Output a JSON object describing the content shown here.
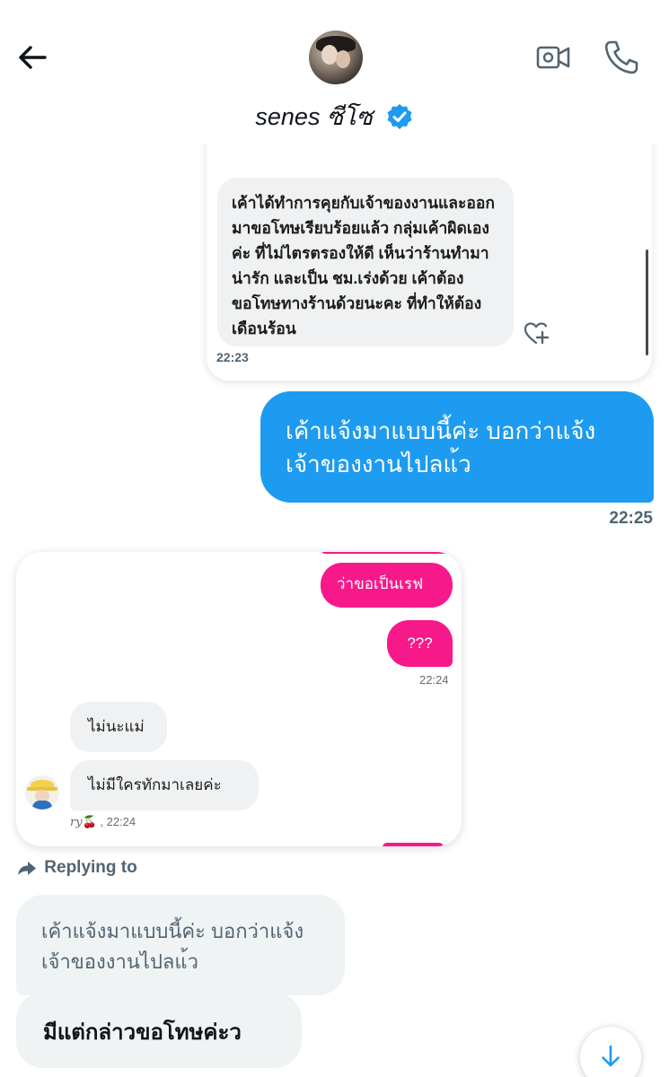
{
  "header": {
    "title": "senes ซีโซ",
    "verified": true,
    "icons": [
      "back-arrow-icon",
      "video-call-icon",
      "phone-call-icon",
      "verified-badge-icon"
    ]
  },
  "card1": {
    "message": "เค้าได้ทำการคุยกับเจ้าของงานและออกมาขอโทษเรียบร้อยแล้ว กลุ่มเค้าผิดเองค่ะ ที่ไม่ไตรตรองให้ดี เห็นว่าร้านทำมาน่ารัก และเป็น ชม.เร่งด้วย เค้าต้องขอโทษทางร้านด้วยนะคะ ที่ทำให้ต้องเดือนร้อน",
    "time": "22:23"
  },
  "outgoing": {
    "message": "เค้าแจ้งมาแบบนี้ค่ะ บอกว่าแจ้งเจ้าของงานไปลแ้ว",
    "time": "22:25",
    "color": "#1d9bf0"
  },
  "card2": {
    "pink_messages": [
      "ว่าขอเป็นเรฟ",
      "???"
    ],
    "pink_time": "22:24",
    "grey_messages": [
      "ไม่นะแม่",
      "ไม่มีใครทักมาเลยค่ะ"
    ],
    "grey_sender": "ry",
    "grey_sender_emoji": "🍒",
    "grey_time": ", 22:24",
    "pink_color": "#f7198a"
  },
  "reply": {
    "label": "Replying to",
    "quoted": "เค้าแจ้งมาแบบนี้ค่ะ บอกว่าแจ้งเจ้าของงานไปลแ้ว",
    "message": "มีแต่กล่าวขอโทษค่ะว"
  },
  "scroll_down_icon": "arrow-down-icon"
}
